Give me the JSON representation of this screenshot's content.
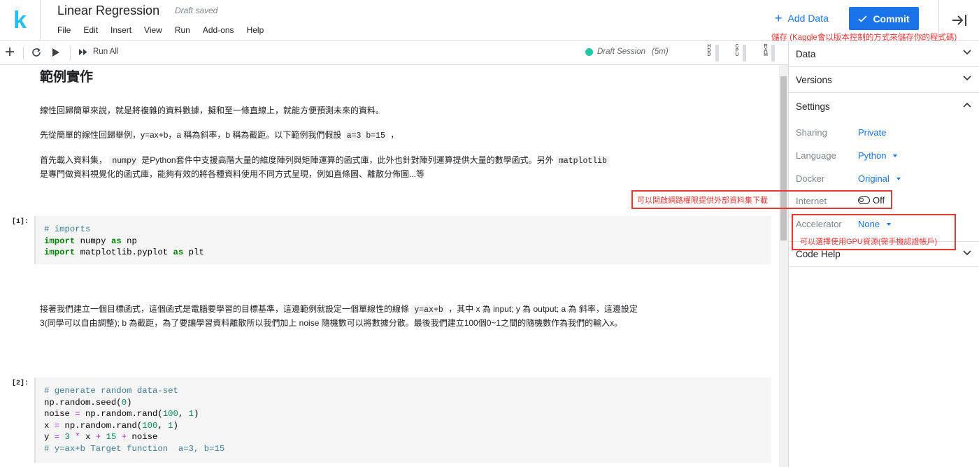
{
  "app": {
    "logo": "k",
    "title": "Linear Regression",
    "draft_status": "Draft saved"
  },
  "menu": [
    "File",
    "Edit",
    "Insert",
    "View",
    "Run",
    "Add-ons",
    "Help"
  ],
  "header": {
    "add_data": "Add Data",
    "commit": "Commit",
    "save_note": "儲存 (Kaggle會以版本控制的方式來儲存你的程式碼)"
  },
  "toolbar": {
    "run_all": "Run All",
    "session": "Draft Session",
    "session_time": "(5m)",
    "resources": [
      "HDD",
      "CPU",
      "RAM"
    ]
  },
  "notebook": {
    "heading": "範例實作",
    "p1": "線性回歸簡單來說，就是將複雜的資料數據，擬和至一條直線上，就能方便預測未來的資料。",
    "p2_a": "先從簡單的線性回歸舉例，y=ax+b，a 稱為斜率，b 稱為截距。以下範例我們假設",
    "p2_code": "a=3  b=15",
    "p2_b": "，",
    "p3_a": "首先載入資料集，",
    "p3_code1": "numpy",
    "p3_b": "是Python套件中支援高階大量的維度陣列與矩陣運算的函式庫，此外也針對陣列運算提供大量的數學函式。另外",
    "p3_code2": "matplotlib",
    "p3_c": "是專門做資料視覺化的函式庫，能夠有效的將各種資料使用不同方式呈現，例如直條圖、離散分佈圖...等",
    "cell1_prompt": "[1]:",
    "cell1_comment": "# imports",
    "cell1_kw_import": "import",
    "cell1_kw_as": "as",
    "cell1_mod1": " numpy ",
    "cell1_alias1": " np",
    "cell1_mod2": " matplotlib.pyplot ",
    "cell1_alias2": " plt",
    "p4_a": "接著我們建立一個目標函式，這個函式是電腦要學習的目標基準，這邊範例就設定一個單線性的線條",
    "p4_code": "y=ax+b",
    "p4_b": "，其中 x 為 input; y 為 output; a 為 斜率，這邊設定3(同學可以自由調整); b 為截距，為了要讓學習資料離散所以我們加上 noise 隨機數可以將數據分散。最後我們建立100個0~1之間的隨機數作為我們的輸入x。",
    "cell2_prompt": "[2]:",
    "cell2_l1": "# generate random data-set",
    "cell2_l2a": "np.random.seed(",
    "cell2_l2n": "0",
    "cell2_l2b": ")",
    "cell2_l3a": "noise ",
    "cell2_l3eq": "=",
    "cell2_l3b": " np.random.rand(",
    "cell2_l3n1": "100",
    "cell2_l3c": ", ",
    "cell2_l3n2": "1",
    "cell2_l3d": ")",
    "cell2_l4a": "x ",
    "cell2_l4eq": "=",
    "cell2_l4b": " np.random.rand(",
    "cell2_l4n1": "100",
    "cell2_l4c": ", ",
    "cell2_l4n2": "1",
    "cell2_l4d": ")",
    "cell2_l5a": "y ",
    "cell2_l5eq": "=",
    "cell2_l5n1": " 3 ",
    "cell2_l5m": "*",
    "cell2_l5b": " x ",
    "cell2_l5p": "+",
    "cell2_l5n2": " 15 ",
    "cell2_l5p2": "+",
    "cell2_l5c": " noise",
    "cell2_l6": "# y=ax+b Target function  a=3, b=15"
  },
  "panel": {
    "data": "Data",
    "versions": "Versions",
    "settings": "Settings",
    "code_help": "Code Help",
    "sharing_label": "Sharing",
    "sharing_value": "Private",
    "language_label": "Language",
    "language_value": "Python",
    "docker_label": "Docker",
    "docker_value": "Original",
    "internet_label": "Internet",
    "internet_value": "Off",
    "accelerator_label": "Accelerator",
    "accelerator_value": "None"
  },
  "annotations": {
    "internet_note": "可以開啟網路權限提供外部資料集下載",
    "gpu_note": "可以選擇使用GPU資源(需手機認證帳戶)",
    "color": "#e53935"
  },
  "colors": {
    "accent": "#1a73e8",
    "brand": "#20beff",
    "session": "#1fc7a7"
  }
}
